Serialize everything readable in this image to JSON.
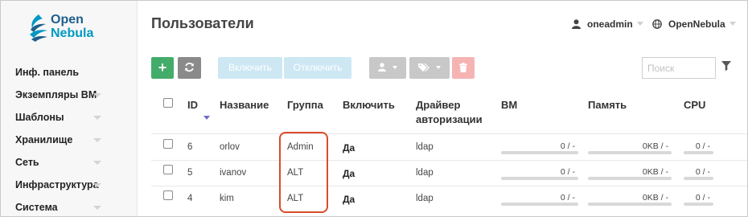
{
  "logo": {
    "line1": "Open",
    "line2": "Nebula"
  },
  "sidebar": {
    "items": [
      {
        "label": "Инф. панель",
        "has_caret": false
      },
      {
        "label": "Экземпляры ВМ",
        "has_caret": true
      },
      {
        "label": "Шаблоны",
        "has_caret": true
      },
      {
        "label": "Хранилище",
        "has_caret": true
      },
      {
        "label": "Сеть",
        "has_caret": true
      },
      {
        "label": "Инфраструктура",
        "has_caret": true
      },
      {
        "label": "Система",
        "has_caret": true
      }
    ]
  },
  "header": {
    "title": "Пользователи",
    "user": "oneadmin",
    "zone": "OpenNebula"
  },
  "toolbar": {
    "add_label": "+",
    "enable_label": "Включить",
    "disable_label": "Отключить",
    "search_placeholder": "Поиск"
  },
  "table": {
    "columns": {
      "id": "ID",
      "name": "Название",
      "group": "Группа",
      "enabled": "Включить",
      "auth_line1": "Драйвер",
      "auth_line2": "авторизации",
      "vm": "ВМ",
      "memory": "Память",
      "cpu": "CPU"
    },
    "rows": [
      {
        "id": "6",
        "name": "orlov",
        "group": "Admin",
        "enabled": "Да",
        "auth": "ldap",
        "vm": "0 / -",
        "memory": "0KB / -",
        "cpu": "0 / -"
      },
      {
        "id": "5",
        "name": "ivanov",
        "group": "ALT",
        "enabled": "Да",
        "auth": "ldap",
        "vm": "0 / -",
        "memory": "0KB / -",
        "cpu": "0 / -"
      },
      {
        "id": "4",
        "name": "kim",
        "group": "ALT",
        "enabled": "Да",
        "auth": "ldap",
        "vm": "0 / -",
        "memory": "0KB / -",
        "cpu": "0 / -"
      }
    ]
  },
  "colors": {
    "accent_add": "#43ac6a",
    "highlight": "#d94b2b",
    "brand": "#1f5f8b"
  }
}
